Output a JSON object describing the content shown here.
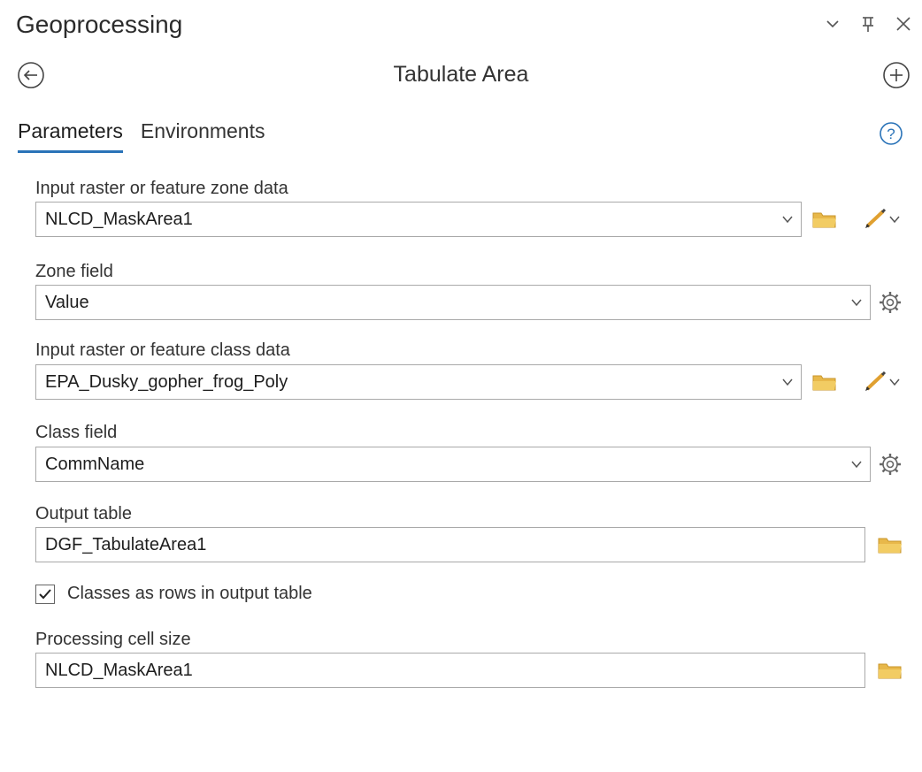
{
  "window": {
    "title": "Geoprocessing",
    "controls": [
      "chevron-down-icon",
      "pin-icon",
      "close-icon"
    ]
  },
  "tool": {
    "title": "Tabulate Area"
  },
  "tabs": [
    {
      "label": "Parameters",
      "active": true
    },
    {
      "label": "Environments",
      "active": false
    }
  ],
  "params": {
    "zone_data": {
      "label": "Input raster or feature zone data",
      "value": "NLCD_MaskArea1"
    },
    "zone_field": {
      "label": "Zone field",
      "value": "Value"
    },
    "class_data": {
      "label": "Input raster or feature class data",
      "value": "EPA_Dusky_gopher_frog_Poly"
    },
    "class_field": {
      "label": "Class field",
      "value": "CommName"
    },
    "output_table": {
      "label": "Output table",
      "value": "DGF_TabulateArea1"
    },
    "classes_as_rows": {
      "label": "Classes as rows in output table",
      "checked": true
    },
    "cell_size": {
      "label": "Processing cell size",
      "value": "NLCD_MaskArea1"
    }
  },
  "colors": {
    "accent": "#2a73b8",
    "folder": "#e8b84a",
    "pencil": "#e0a030"
  }
}
